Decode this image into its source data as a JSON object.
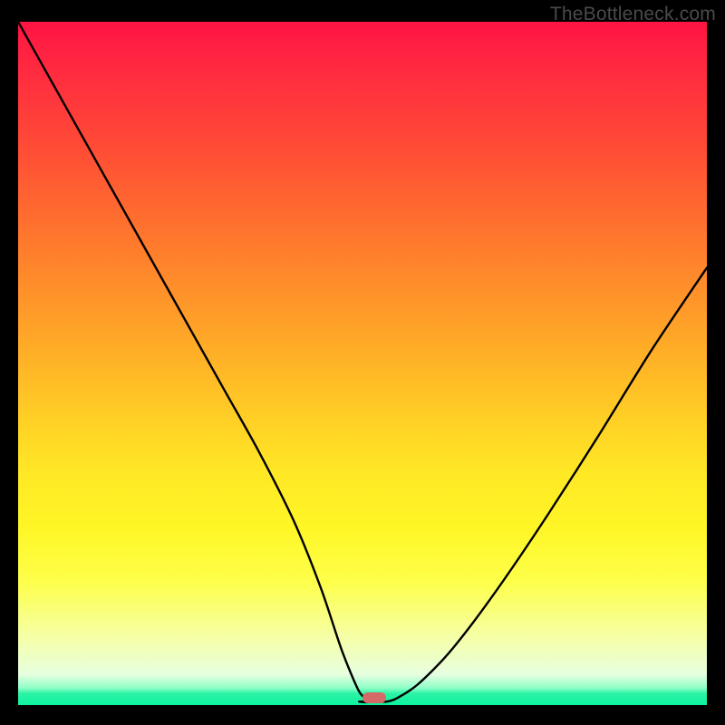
{
  "watermark": "TheBottleneck.com",
  "marker": {
    "x_pct": 51.7,
    "y_pct": 99.0,
    "color": "#d46a67"
  },
  "chart_data": {
    "type": "line",
    "title": "",
    "xlabel": "",
    "ylabel": "",
    "xlim": [
      0,
      100
    ],
    "ylim": [
      0,
      100
    ],
    "grid": false,
    "legend": false,
    "series": [
      {
        "name": "left-branch",
        "x": [
          0,
          5,
          10,
          15,
          20,
          25,
          30,
          35,
          40,
          44,
          47,
          49.5,
          51
        ],
        "y": [
          100,
          91,
          82,
          73,
          64,
          55,
          46,
          37,
          27,
          17,
          8,
          2,
          0.5
        ]
      },
      {
        "name": "flat-min",
        "x": [
          49.5,
          51,
          53.5,
          55
        ],
        "y": [
          0.5,
          0.5,
          0.5,
          1
        ]
      },
      {
        "name": "right-branch",
        "x": [
          55,
          58,
          62,
          66,
          71,
          77,
          84,
          92,
          100
        ],
        "y": [
          1,
          3,
          7,
          12,
          19,
          28,
          39,
          52,
          64
        ]
      }
    ],
    "annotations": [
      {
        "type": "marker",
        "x": 51.7,
        "y": 0.7,
        "shape": "pill",
        "color": "#d46a67"
      }
    ],
    "background": "vertical-gradient red→orange→yellow→green"
  }
}
